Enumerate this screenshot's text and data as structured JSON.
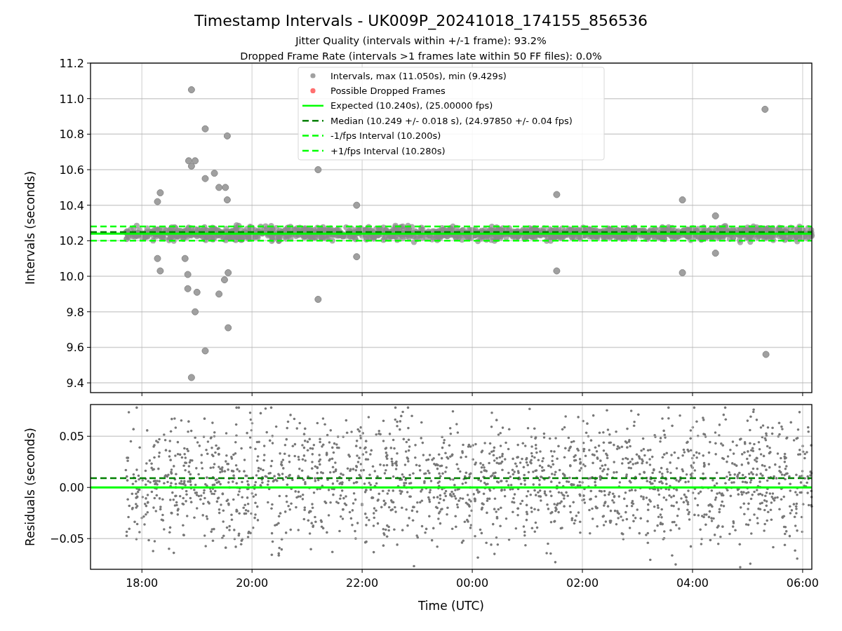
{
  "figure": {
    "title": "Timestamp Intervals - UK009P_20241018_174155_856536",
    "subtitles": [
      "Jitter Quality (intervals within +/-1 frame): 93.2%",
      "Dropped Frame Rate (intervals >1 frames late within 50 FF files): 0.0%"
    ]
  },
  "intervals_plot": {
    "chart_data": {
      "type": "scatter",
      "grid": true,
      "legend": true,
      "ylabel": "Intervals (seconds)",
      "xlim": [
        "2024-10-18T17:04",
        "2024-10-19T06:10"
      ],
      "ylim": [
        9.345,
        11.2
      ],
      "yticks": [
        {
          "value": 9.4,
          "label": "9.4"
        },
        {
          "value": 9.6,
          "label": "9.6"
        },
        {
          "value": 9.8,
          "label": "9.8"
        },
        {
          "value": 10.0,
          "label": "10.0"
        },
        {
          "value": 10.2,
          "label": "10.2"
        },
        {
          "value": 10.4,
          "label": "10.4"
        },
        {
          "value": 10.6,
          "label": "10.6"
        },
        {
          "value": 10.8,
          "label": "10.8"
        },
        {
          "value": 11.0,
          "label": "11.0"
        },
        {
          "value": 11.2,
          "label": "11.2"
        }
      ],
      "series": [
        {
          "name": "Intervals, max (11.050s), min (9.429s)",
          "color": "#a0a0a0",
          "x": [
            "2024-10-18T18:54",
            "2024-10-18T19:09",
            "2024-10-18T19:33",
            "2024-10-18T18:51",
            "2024-10-18T18:58",
            "2024-10-18T18:54",
            "2024-10-18T19:09",
            "2024-10-18T19:19",
            "2024-10-18T21:12",
            "2024-10-19T05:19",
            "2024-10-19T01:32",
            "2024-10-19T03:49",
            "2024-10-18T18:20",
            "2024-10-18T18:17",
            "2024-10-18T21:54",
            "2024-10-19T04:25",
            "2024-10-18T19:24",
            "2024-10-18T19:31",
            "2024-10-18T19:33",
            "2024-10-18T18:47",
            "2024-10-18T18:17",
            "2024-10-18T18:20",
            "2024-10-18T18:50",
            "2024-10-18T19:34",
            "2024-10-18T19:30",
            "2024-10-19T01:32",
            "2024-10-19T03:49",
            "2024-10-19T04:25",
            "2024-10-18T21:12",
            "2024-10-18T21:54",
            "2024-10-18T18:58",
            "2024-10-18T19:09",
            "2024-10-18T19:34",
            "2024-10-18T18:54",
            "2024-10-19T05:20",
            "2024-10-18T19:24",
            "2024-10-18T18:50",
            "2024-10-18T19:00"
          ],
          "values": [
            11.05,
            10.83,
            10.79,
            10.65,
            10.65,
            10.62,
            10.55,
            10.58,
            10.6,
            10.94,
            10.46,
            10.43,
            10.47,
            10.42,
            10.4,
            10.34,
            10.5,
            10.5,
            10.43,
            10.1,
            10.1,
            10.03,
            10.01,
            10.02,
            9.98,
            10.03,
            10.02,
            10.13,
            9.87,
            10.11,
            9.8,
            9.58,
            9.71,
            9.43,
            9.56,
            9.9,
            9.93,
            9.91
          ]
        },
        {
          "name": "Possible Dropped Frames",
          "color": "#ff7070"
        }
      ],
      "ref_lines": [
        {
          "axis": "y",
          "value": 10.24,
          "label": "Expected (10.240s), (25.00000 fps)",
          "color": "#00ff00"
        },
        {
          "axis": "y",
          "value": 10.249,
          "label": "Median (10.249 +/- 0.018 s), (24.97850 +/- 0.04 fps)",
          "color": "#008000"
        },
        {
          "axis": "y",
          "value": 10.2,
          "label": "-1/fps Interval (10.200s)",
          "color": "#00ff00"
        },
        {
          "axis": "y",
          "value": 10.28,
          "label": "+1/fps Interval (10.280s)",
          "color": "#00ff00"
        }
      ]
    }
  },
  "residuals_plot": {
    "chart_data": {
      "type": "scatter",
      "grid": true,
      "xlabel": "Time (UTC)",
      "ylabel": "Residuals (seconds)",
      "xlim": [
        "2024-10-18T17:04",
        "2024-10-19T06:10"
      ],
      "ylim": [
        -0.08,
        0.081
      ],
      "xticks": [
        {
          "value": "2024-10-18T18:00",
          "label": "18:00"
        },
        {
          "value": "2024-10-18T20:00",
          "label": "20:00"
        },
        {
          "value": "2024-10-18T22:00",
          "label": "22:00"
        },
        {
          "value": "2024-10-19T00:00",
          "label": "00:00"
        },
        {
          "value": "2024-10-19T02:00",
          "label": "02:00"
        },
        {
          "value": "2024-10-19T04:00",
          "label": "04:00"
        },
        {
          "value": "2024-10-19T06:00",
          "label": "06:00"
        }
      ],
      "yticks": [
        {
          "value": -0.05,
          "label": "−0.05"
        },
        {
          "value": 0,
          "label": "0.00"
        },
        {
          "value": 0.05,
          "label": "0.05"
        }
      ],
      "ref_lines": [
        {
          "axis": "y",
          "value": 0,
          "color": "#00ff00"
        },
        {
          "axis": "y",
          "value": 0.009,
          "color": "#008000"
        }
      ]
    }
  }
}
